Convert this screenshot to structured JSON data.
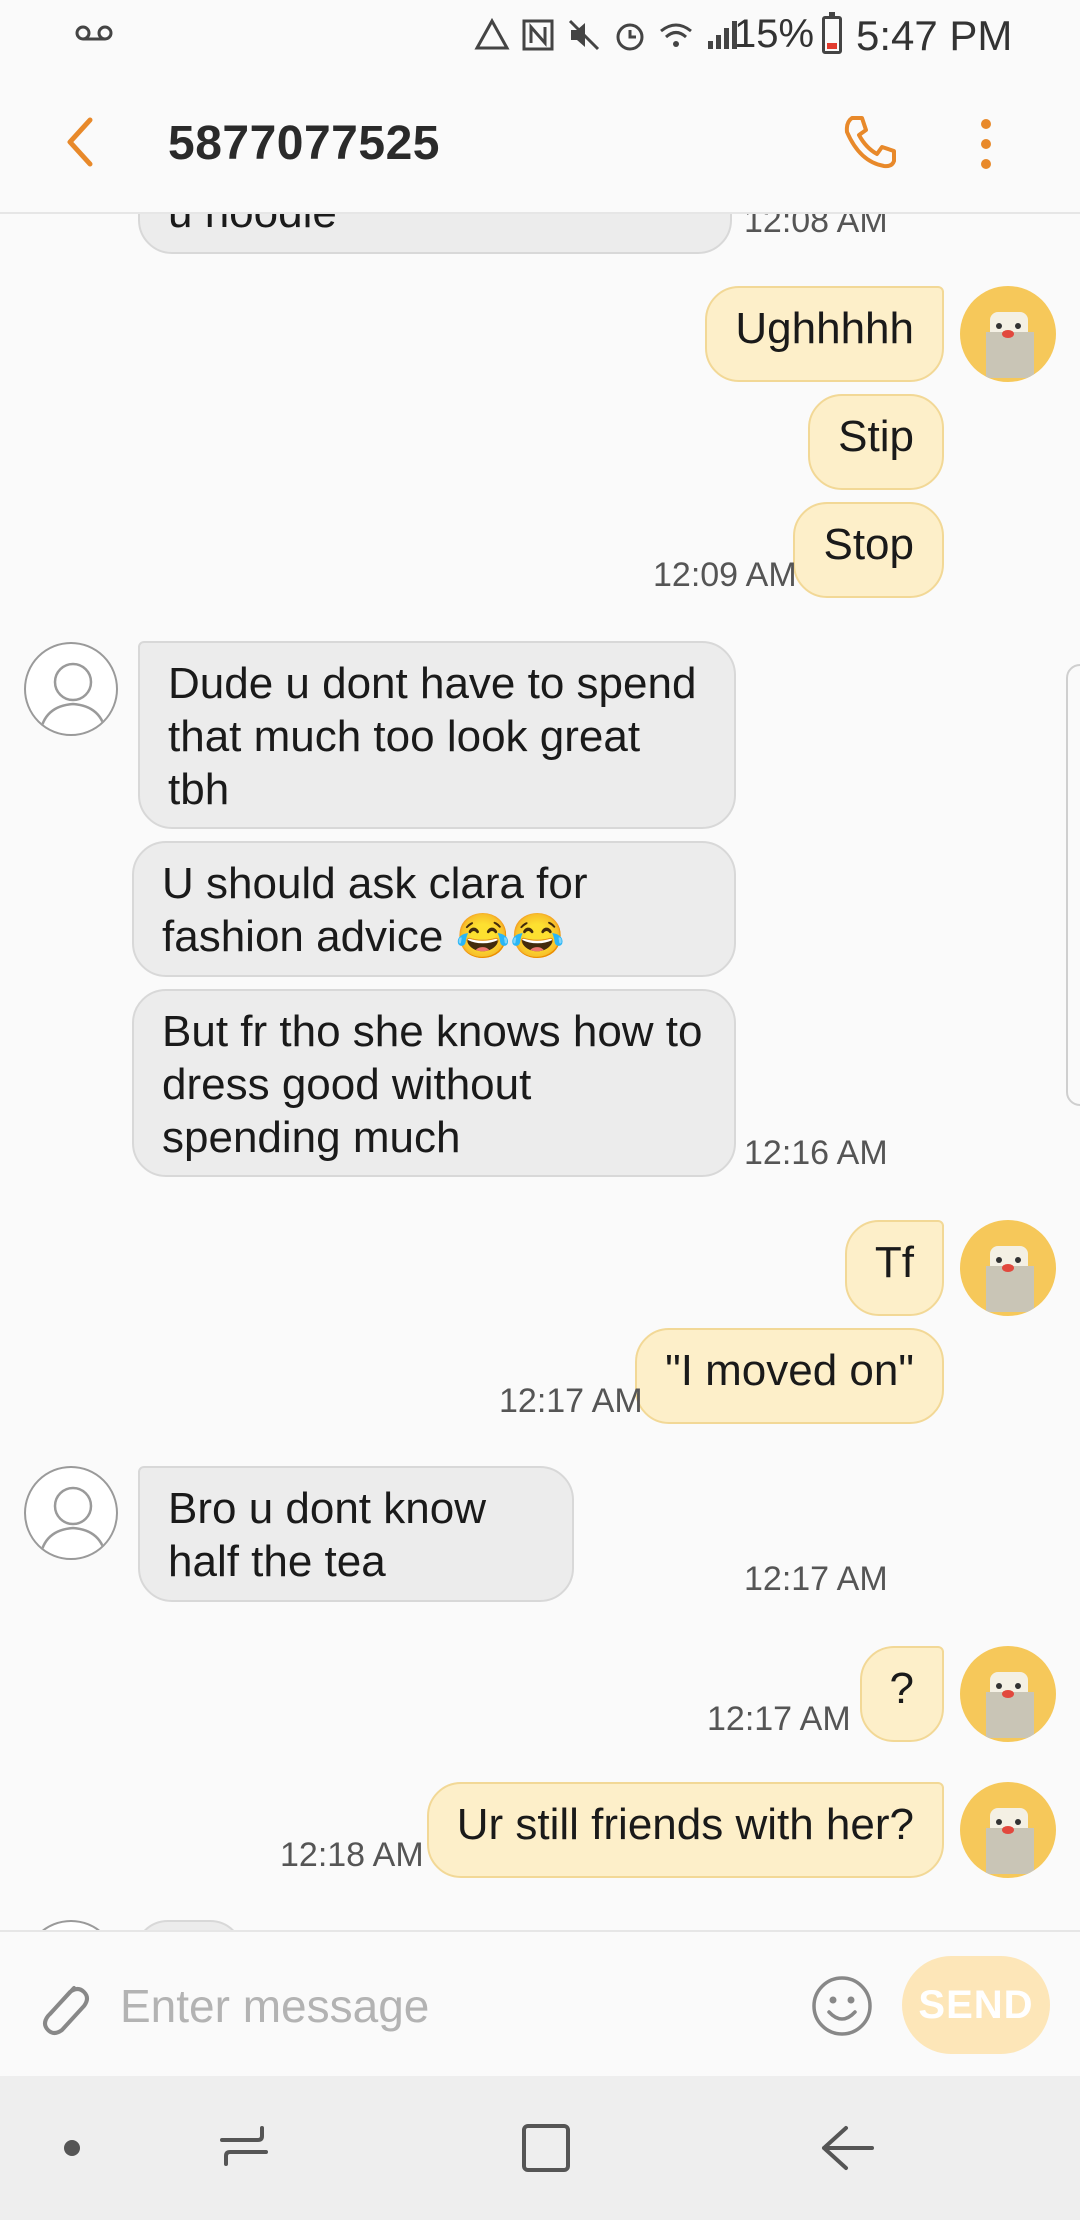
{
  "status_bar": {
    "battery_percent": "15%",
    "time": "5:47 PM"
  },
  "header": {
    "title": "5877077525",
    "back_icon": "chevron-left-icon",
    "call_icon": "phone-icon",
    "more_icon": "more-vert-icon"
  },
  "messages": [
    {
      "direction": "in",
      "text": "u noodle",
      "time": "12:08 AM"
    },
    {
      "direction": "out",
      "text": "Ughhhhh"
    },
    {
      "direction": "out",
      "text": "Stip"
    },
    {
      "direction": "out",
      "text": "Stop",
      "time": "12:09 AM"
    },
    {
      "direction": "in",
      "text": "Dude u dont have to spend that much too look great tbh"
    },
    {
      "direction": "in",
      "text": "U should ask clara for fashion advice 😂😂"
    },
    {
      "direction": "in",
      "text": "But fr tho she knows how to dress good without spending much",
      "time": "12:16 AM"
    },
    {
      "direction": "out",
      "text": "Tf"
    },
    {
      "direction": "out",
      "text": "\"I moved on\"",
      "time": "12:17 AM"
    },
    {
      "direction": "in",
      "text": "Bro u dont know half the tea",
      "time": "12:17 AM"
    },
    {
      "direction": "out",
      "text": "?",
      "time": "12:17 AM"
    },
    {
      "direction": "out",
      "text": "Ur still friends with her?",
      "time": "12:18 AM"
    }
  ],
  "input": {
    "placeholder": "Enter message",
    "send_label": "SEND"
  },
  "colors": {
    "accent": "#e8892a",
    "outgoing_bubble": "#fdefc9",
    "incoming_bubble": "#ececec",
    "send_button": "#fde6b8"
  }
}
